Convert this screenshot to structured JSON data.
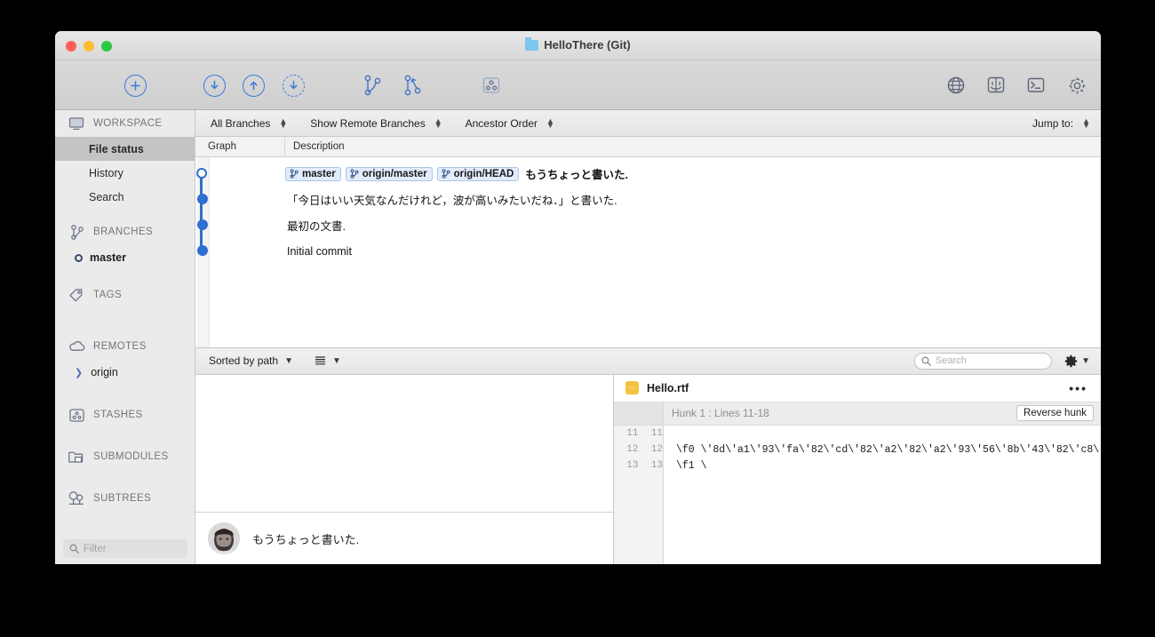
{
  "window": {
    "title": "HelloThere (Git)",
    "title_icon": "folder-icon",
    "traffic": {
      "close": "close-button",
      "minimize": "minimize-button",
      "maximize": "maximize-button"
    }
  },
  "toolbar": {
    "left_buttons": [
      {
        "name": "commit-button",
        "icon": "plus-circle-icon",
        "glyph": "+"
      },
      {
        "name": "pull-button",
        "icon": "arrow-down-circle-icon",
        "glyph": "↓"
      },
      {
        "name": "push-button",
        "icon": "arrow-up-circle-icon",
        "glyph": "↑"
      },
      {
        "name": "fetch-button",
        "icon": "arrow-down-dashed-circle-icon",
        "glyph": "↓"
      },
      {
        "name": "branch-button",
        "icon": "branch-icon",
        "glyph": ""
      },
      {
        "name": "merge-button",
        "icon": "merge-icon",
        "glyph": ""
      },
      {
        "name": "stash-button",
        "icon": "stash-icon",
        "glyph": ""
      }
    ],
    "right_buttons": [
      {
        "name": "remote-button",
        "icon": "globe-icon"
      },
      {
        "name": "finder-button",
        "icon": "finder-icon"
      },
      {
        "name": "terminal-button",
        "icon": "terminal-icon"
      },
      {
        "name": "settings-button",
        "icon": "gear-icon"
      }
    ]
  },
  "sidebar": {
    "groups": [
      {
        "label": "WORKSPACE",
        "icon": "display-icon"
      },
      {
        "label": "BRANCHES",
        "icon": "branch-icon"
      },
      {
        "label": "TAGS",
        "icon": "tag-icon"
      },
      {
        "label": "REMOTES",
        "icon": "cloud-icon"
      },
      {
        "label": "STASHES",
        "icon": "stash-icon"
      },
      {
        "label": "SUBMODULES",
        "icon": "submodule-icon"
      },
      {
        "label": "SUBTREES",
        "icon": "subtree-icon"
      }
    ],
    "workspace_items": [
      {
        "label": "File status",
        "selected": true
      },
      {
        "label": "History",
        "selected": false
      },
      {
        "label": "Search",
        "selected": false
      }
    ],
    "branches": [
      {
        "label": "master",
        "current": true
      }
    ],
    "remotes": [
      {
        "label": "origin",
        "expanded": false
      }
    ],
    "filter": {
      "placeholder": "Filter",
      "value": "",
      "icon": "search-icon"
    }
  },
  "filterbar": {
    "selects": [
      {
        "label": "All Branches"
      },
      {
        "label": "Show Remote Branches"
      },
      {
        "label": "Ancestor Order"
      }
    ],
    "jump_to": {
      "label": "Jump to:"
    }
  },
  "columns": [
    {
      "label": "Graph"
    },
    {
      "label": "Description"
    }
  ],
  "commits": [
    {
      "message": "もうちょっと書いた.",
      "bold": true,
      "node": "hollow",
      "badges": [
        {
          "label": "master",
          "icon": "branch-icon"
        },
        {
          "label": "origin/master",
          "icon": "branch-icon"
        },
        {
          "label": "origin/HEAD",
          "icon": "branch-icon"
        }
      ]
    },
    {
      "message": "「今日はいい天気なんだけれど，波が高いみたいだね．」と書いた.",
      "bold": false,
      "node": "filled",
      "badges": []
    },
    {
      "message": "最初の文書.",
      "bold": false,
      "node": "filled",
      "badges": []
    },
    {
      "message": "Initial commit",
      "bold": false,
      "node": "filled",
      "badges": []
    }
  ],
  "bottombar": {
    "sort": {
      "label": "Sorted by path",
      "icon": "chevron-down-icon"
    },
    "view": {
      "icon": "list-view-icon",
      "chevron": "chevron-down-icon"
    },
    "search": {
      "placeholder": "Search",
      "value": "",
      "icon": "search-icon"
    },
    "gear": {
      "icon": "gear-icon",
      "chevron": "chevron-down-icon"
    }
  },
  "commit_detail": {
    "avatar": "avatar",
    "message": "もうちょっと書いた."
  },
  "diff": {
    "filename": "Hello.rtf",
    "file_icon": "rtf-file-icon",
    "more": "•••",
    "hunk_label": "Hunk 1 : Lines 11-18",
    "reverse_button": "Reverse hunk",
    "lines": [
      {
        "old": "11",
        "new": "11",
        "text": ""
      },
      {
        "old": "12",
        "new": "12",
        "text": "\\f0 \\'8d\\'a1\\'93\\'fa\\'82\\'cd\\'82\\'a2\\'82\\'a2\\'93\\'56\\'8b\\'43\\'82\\'c8\\'"
      },
      {
        "old": "13",
        "new": "13",
        "text": "\\f1 \\"
      }
    ]
  },
  "colors": {
    "accent_blue": "#2f6fd0",
    "badge_bg": "#e2ecfb",
    "badge_border": "#a9c6e8",
    "selection_gray": "#c4c4c4",
    "file_icon_yellow": "#f5c242"
  }
}
